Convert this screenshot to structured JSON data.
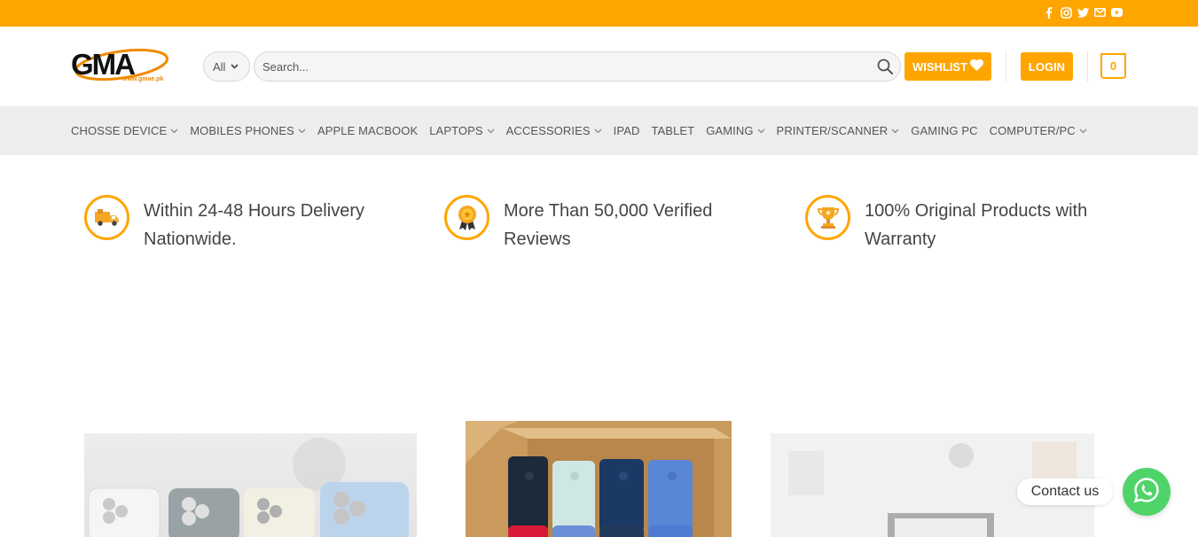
{
  "topbar": {
    "icons": [
      "facebook-icon",
      "instagram-icon",
      "twitter-icon",
      "email-icon",
      "youtube-icon"
    ]
  },
  "header": {
    "logo_text": "GMA",
    "logo_url_text": "www.gmae.pk",
    "category_select": "All",
    "search_placeholder": "Search...",
    "wishlist_label": "WISHLIST",
    "login_label": "LOGIN",
    "cart_count": "0"
  },
  "nav": {
    "items": [
      {
        "label": "CHOSSE DEVICE",
        "dropdown": true
      },
      {
        "label": "MOBILES PHONES",
        "dropdown": true
      },
      {
        "label": "APPLE MACBOOK",
        "dropdown": false
      },
      {
        "label": "LAPTOPS",
        "dropdown": true
      },
      {
        "label": "ACCESSORIES",
        "dropdown": true
      },
      {
        "label": "IPAD",
        "dropdown": false
      },
      {
        "label": "TABLET",
        "dropdown": false
      },
      {
        "label": "GAMING",
        "dropdown": true
      },
      {
        "label": "PRINTER/SCANNER",
        "dropdown": true
      },
      {
        "label": "GAMING PC",
        "dropdown": false
      },
      {
        "label": "COMPUTER/PC",
        "dropdown": true
      }
    ]
  },
  "features": [
    {
      "icon": "delivery-truck-icon",
      "line1": "Within 24-48 Hours Delivery",
      "line2": "Nationwide."
    },
    {
      "icon": "award-medal-icon",
      "line1": "More Than 50,000 Verified",
      "line2": "Reviews"
    },
    {
      "icon": "trophy-icon",
      "line1": "100% Original Products with",
      "line2": "Warranty"
    }
  ],
  "contact": {
    "label": "Contact us",
    "icon": "whatsapp-icon"
  },
  "colors": {
    "accent": "#ffa500",
    "nav_bg": "#ededed",
    "whatsapp": "#4fd46a"
  }
}
